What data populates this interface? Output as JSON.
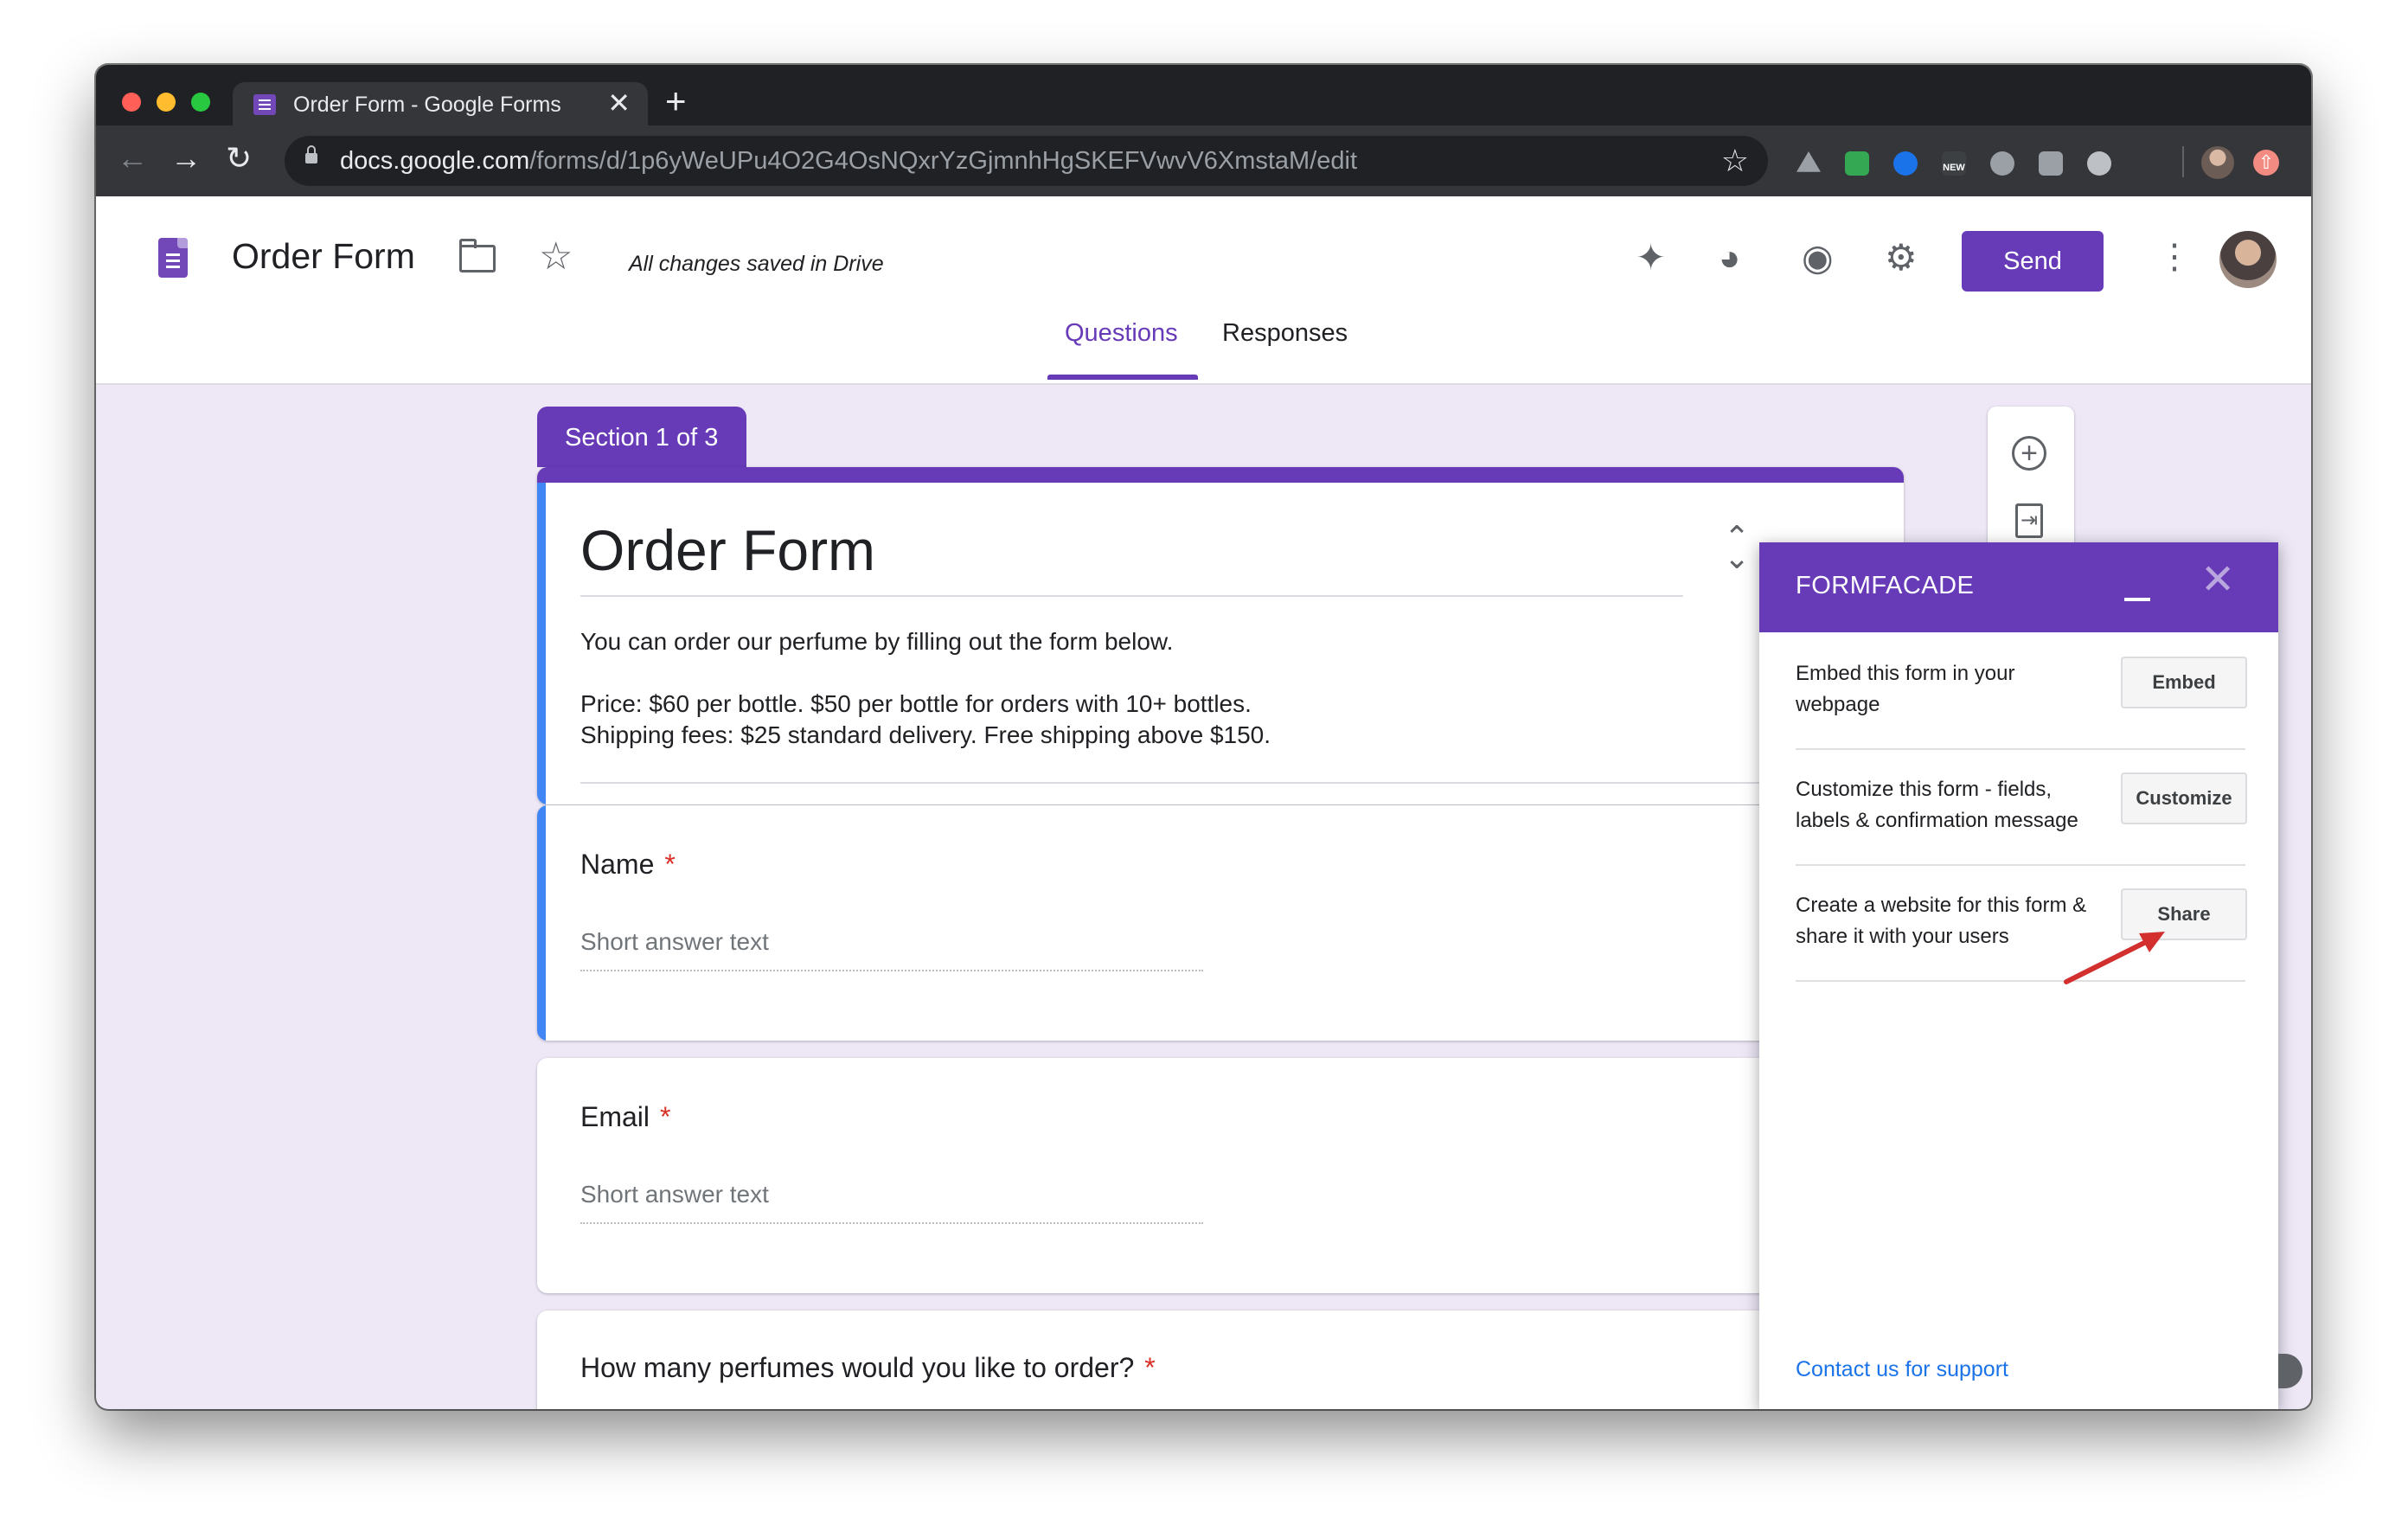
{
  "browser": {
    "tab_title": "Order Form - Google Forms",
    "tab_close": "✕",
    "new_tab": "+",
    "url_host": "docs.google.com",
    "url_path": "/forms/d/1p6yWeUPu4O2G4OsNQxrYzGjmnhHgSKEFVwvV6XmstaM/edit",
    "extension_badge": "NEW",
    "glyphs": {
      "back": "←",
      "forward": "→",
      "reload": "↻",
      "bookmark": "☆",
      "update": "⇧"
    }
  },
  "header": {
    "title": "Order Form",
    "save_status": "All changes saved in Drive",
    "send_label": "Send",
    "glyphs": {
      "star": "☆",
      "more": "⋮",
      "addons": "✦",
      "palette": "◕",
      "preview": "◉",
      "settings": "⚙"
    },
    "tabs": [
      {
        "label": "Questions",
        "active": true
      },
      {
        "label": "Responses",
        "active": false
      }
    ]
  },
  "form": {
    "section_label": "Section 1 of 3",
    "title": "Order Form",
    "description": [
      "You can order our perfume by filling out the form below.",
      "",
      "Price: $60 per bottle. $50 per bottle for orders with 10+ bottles.",
      "Shipping fees: $25 standard delivery. Free shipping above $150."
    ],
    "collapse_glyph": "⌄",
    "questions": [
      {
        "label": "Name",
        "required_mark": "*",
        "placeholder": "Short answer text"
      },
      {
        "label": "Email",
        "required_mark": "*",
        "placeholder": "Short answer text"
      },
      {
        "label": "How many perfumes would you like to order?",
        "required_mark": "*"
      }
    ],
    "side_tools": {
      "add_glyph": "+",
      "import_glyph": "⇥"
    }
  },
  "formfacade": {
    "title": "FORMFACADE",
    "close_glyph": "✕",
    "rows": [
      {
        "text": "Embed this form in your webpage",
        "button": "Embed"
      },
      {
        "text": "Customize this form - fields, labels & confirmation message",
        "button": "Customize"
      },
      {
        "text": "Create a website for this form & share it with your users",
        "button": "Share"
      }
    ],
    "support_link": "Contact us for support"
  },
  "colors": {
    "accent": "#673ab7",
    "canvas_bg": "#ede7f6",
    "question_border": "#4285f4",
    "required": "#d93025",
    "link": "#1a73e8",
    "annotation_arrow": "#d32f2f"
  }
}
